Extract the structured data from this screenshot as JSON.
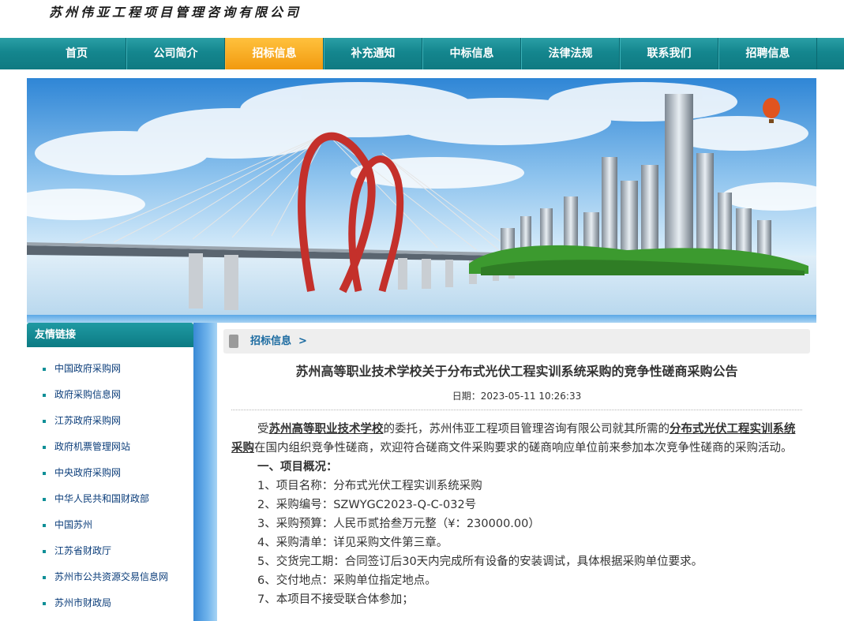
{
  "company": {
    "name": "苏州伟亚工程项目管理咨询有限公司"
  },
  "nav": {
    "items": [
      "首页",
      "公司简介",
      "招标信息",
      "补充通知",
      "中标信息",
      "法律法规",
      "联系我们",
      "招聘信息"
    ],
    "active_index": 2
  },
  "sidebar": {
    "title": "友情链接",
    "links": [
      "中国政府采购网",
      "政府采购信息网",
      "江苏政府采购网",
      "政府机票管理网站",
      "中央政府采购网",
      "中华人民共和国财政部",
      "中国苏州",
      "江苏省财政厅",
      "苏州市公共资源交易信息网",
      "苏州市财政局"
    ]
  },
  "breadcrumb": {
    "label": "招标信息",
    "separator": ">"
  },
  "article": {
    "title": "苏州高等职业技术学校关于分布式光伏工程实训系统采购的竞争性磋商采购公告",
    "date": "日期：2023-05-11 10:26:33",
    "intro_pre": "受",
    "intro_org": "苏州高等职业技术学校",
    "intro_mid": "的委托，苏州伟亚工程项目管理咨询有限公司就其所需的",
    "intro_project": "分布式光伏工程实训系统采购",
    "intro_post": "在国内组织竞争性磋商，欢迎符合磋商文件采购要求的磋商响应单位前来参加本次竞争性磋商的采购活动。",
    "section1": "一、项目概况：",
    "lines": [
      "1、项目名称：分布式光伏工程实训系统采购",
      "2、采购编号：SZWYGC2023-Q-C-032号",
      "3、采购预算：人民币贰拾叁万元整（¥：230000.00）",
      "4、采购清单：详见采购文件第三章。",
      "5、交货完工期：合同签订后30天内完成所有设备的安装调试，具体根据采购单位要求。",
      "6、交付地点：采购单位指定地点。",
      "7、本项目不接受联合体参加；"
    ]
  },
  "colors": {
    "nav": "#14868e",
    "active": "#f5a623",
    "link": "#0b3d7a"
  }
}
